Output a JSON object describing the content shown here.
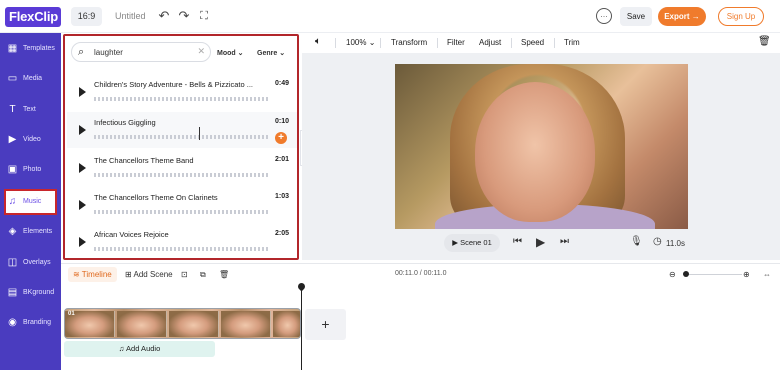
{
  "app": {
    "logo": "FlexClip"
  },
  "topbar": {
    "ratio": "16:9",
    "project_title": "Untitled",
    "save_label": "Save",
    "export_label": "Export",
    "signup_label": "Sign Up"
  },
  "sidebar": {
    "items": [
      {
        "label": "Templates",
        "icon": "templates-icon"
      },
      {
        "label": "Media",
        "icon": "folder-icon"
      },
      {
        "label": "Text",
        "icon": "text-icon"
      },
      {
        "label": "Video",
        "icon": "video-icon"
      },
      {
        "label": "Photo",
        "icon": "photo-icon"
      },
      {
        "label": "Music",
        "icon": "music-icon",
        "active": true
      },
      {
        "label": "Elements",
        "icon": "elements-icon"
      },
      {
        "label": "Overlays",
        "icon": "overlays-icon"
      },
      {
        "label": "BKground",
        "icon": "background-icon"
      },
      {
        "label": "Branding",
        "icon": "branding-icon"
      }
    ]
  },
  "music_panel": {
    "search_value": "laughter",
    "mood_label": "Mood",
    "genre_label": "Genre",
    "tracks": [
      {
        "name": "Children's Story Adventure - Bells & Pizzicato ...",
        "duration": "0:49"
      },
      {
        "name": "Infectious Giggling",
        "duration": "0:10"
      },
      {
        "name": "The Chancellors Theme Band",
        "duration": "2:01"
      },
      {
        "name": "The Chancellors Theme On Clarinets",
        "duration": "1:03"
      },
      {
        "name": "African Voices Rejoice",
        "duration": "2:05"
      }
    ]
  },
  "edit_toolbar": {
    "zoom": "100%",
    "transform": "Transform",
    "filter": "Filter",
    "adjust": "Adjust",
    "speed": "Speed",
    "trim": "Trim"
  },
  "player": {
    "scene_label": "Scene 01",
    "duration": "11.0s"
  },
  "timeline": {
    "tab_label": "Timeline",
    "add_scene_label": "Add Scene",
    "time_readout": "00:11.0 / 00:11.0",
    "clip_number": "01",
    "add_audio_label": "Add Audio"
  },
  "colors": {
    "brand": "#4a3cbf",
    "accent": "#f07b2c",
    "highlight": "#b2262b"
  }
}
